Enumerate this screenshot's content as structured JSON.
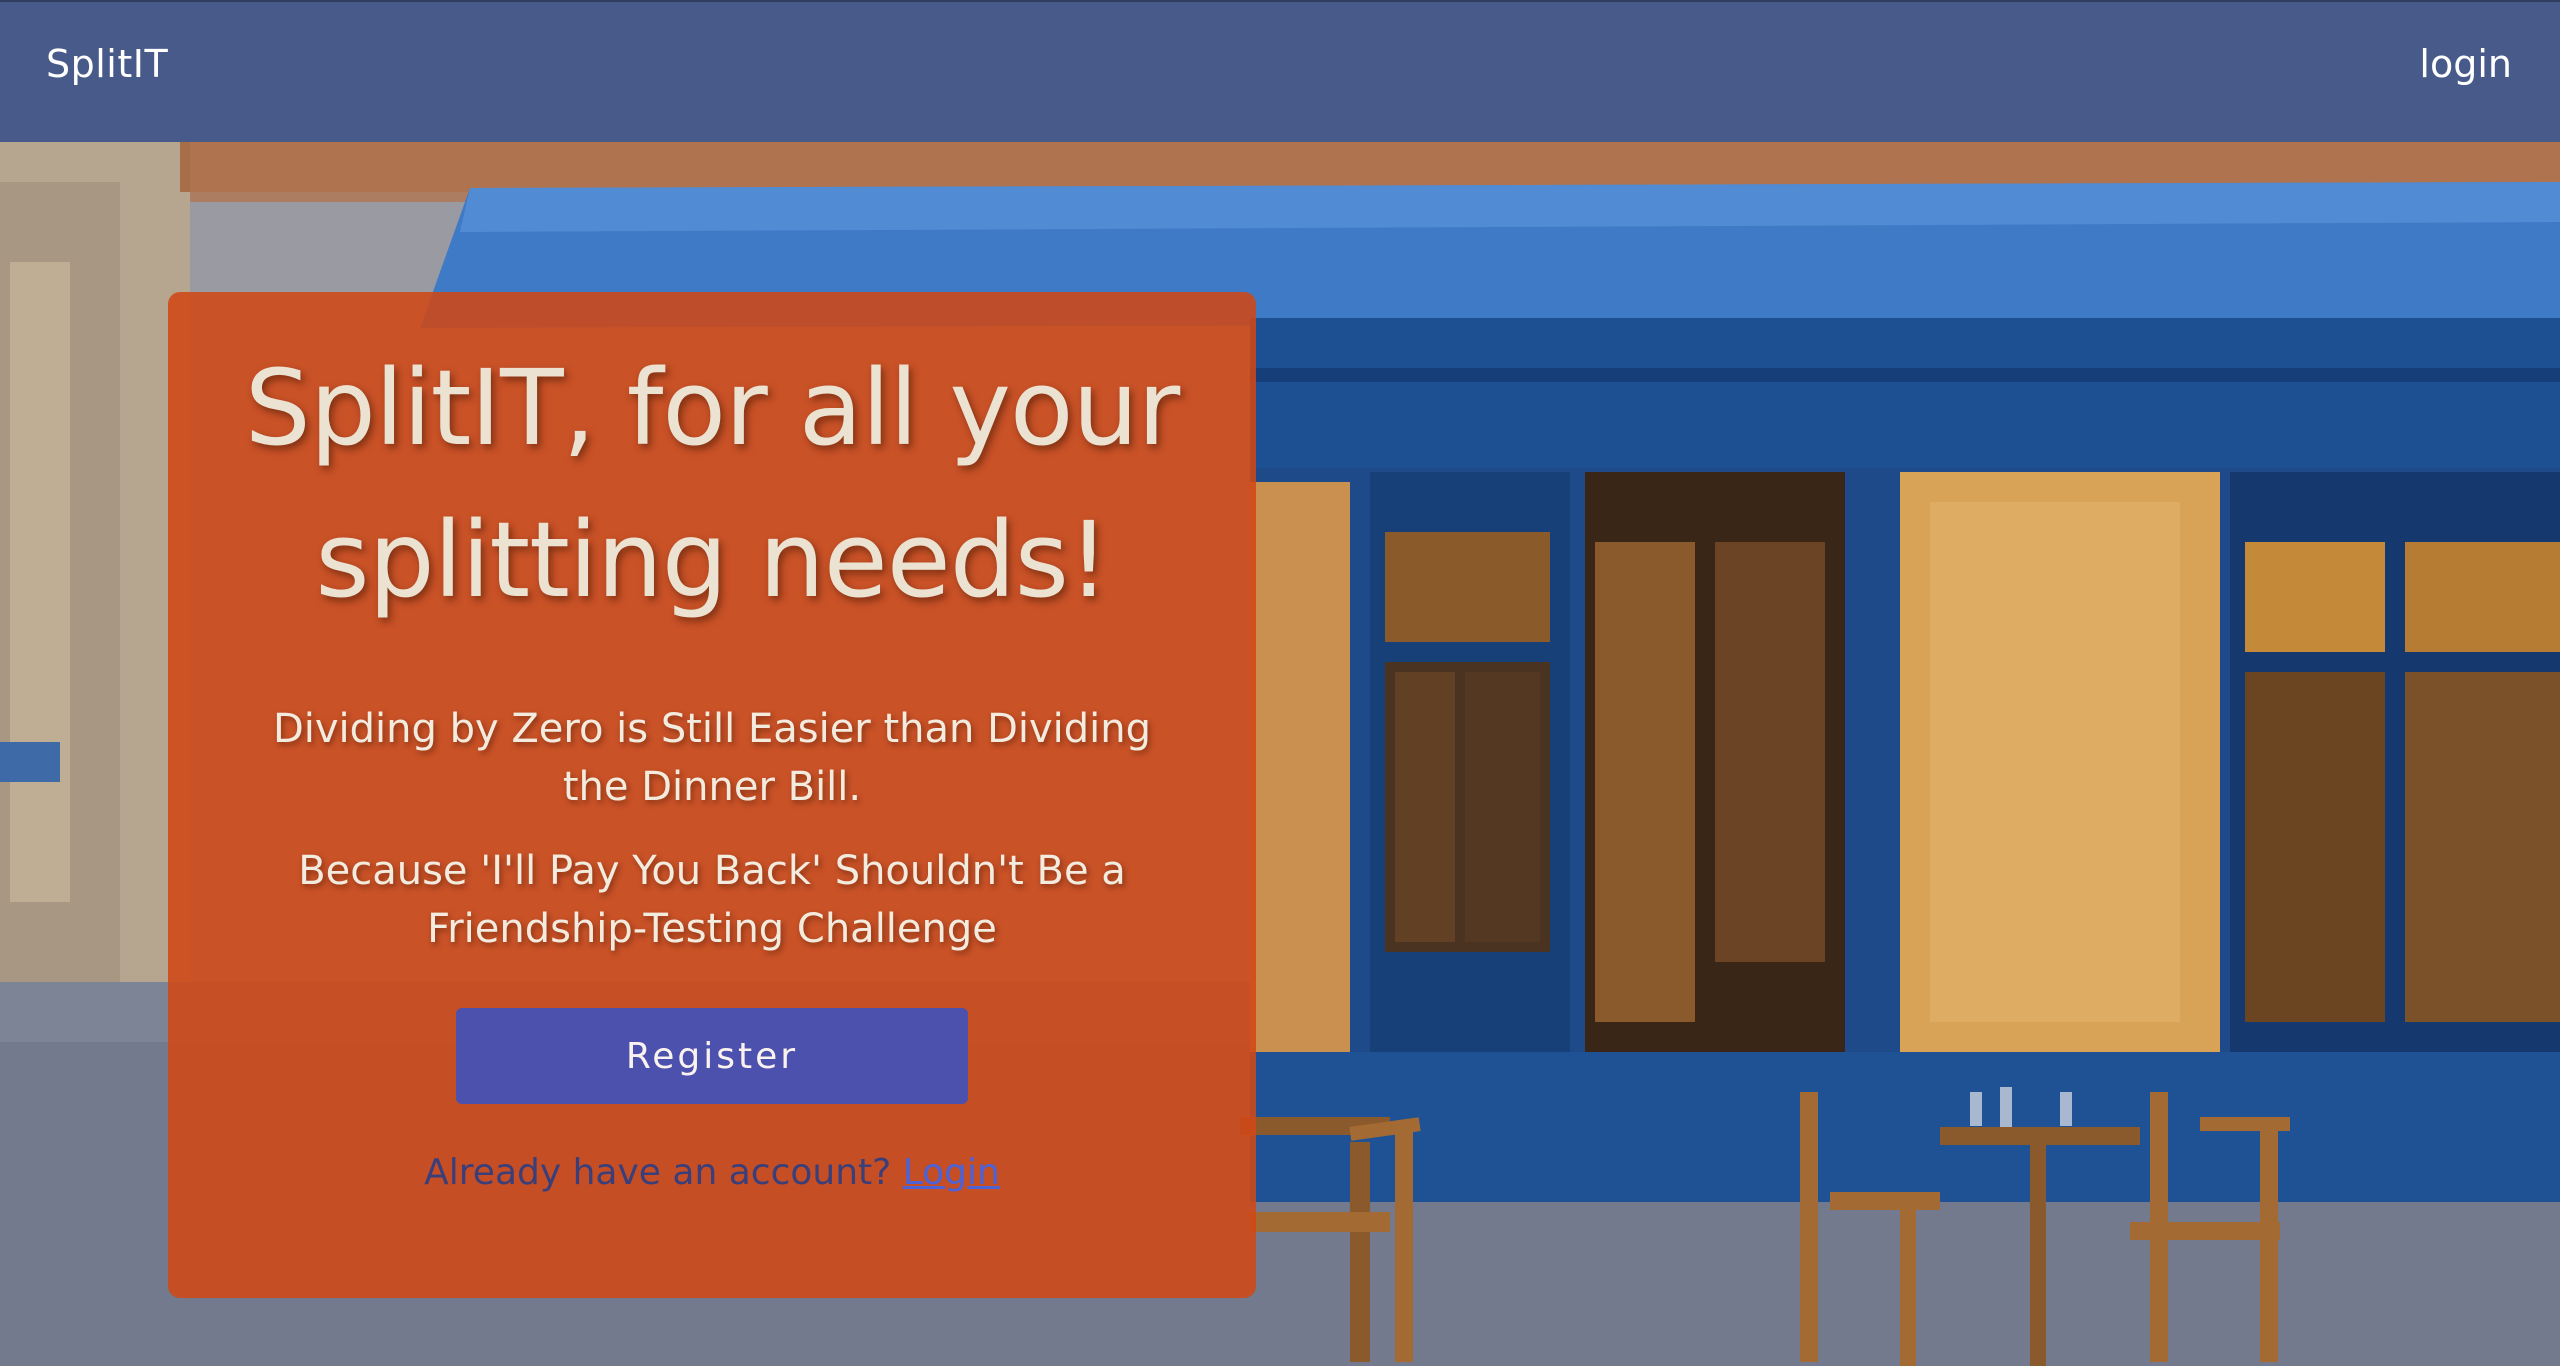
{
  "navbar": {
    "brand": "SplitIT",
    "login_label": "login"
  },
  "hero": {
    "title": "SplitIT, for all your splitting needs!",
    "tagline_1": "Dividing by Zero is Still Easier than Dividing the Dinner Bill.",
    "tagline_2": "Because 'I'll Pay You Back' Shouldn't Be a Friendship-Testing Challenge",
    "register_label": "Register",
    "account_prompt": "Already have an account?",
    "login_link": "Login"
  },
  "colors": {
    "navbar": "#475a8a",
    "card": "#d04816",
    "register_button": "#4352b8",
    "link": "#4b63d6"
  }
}
